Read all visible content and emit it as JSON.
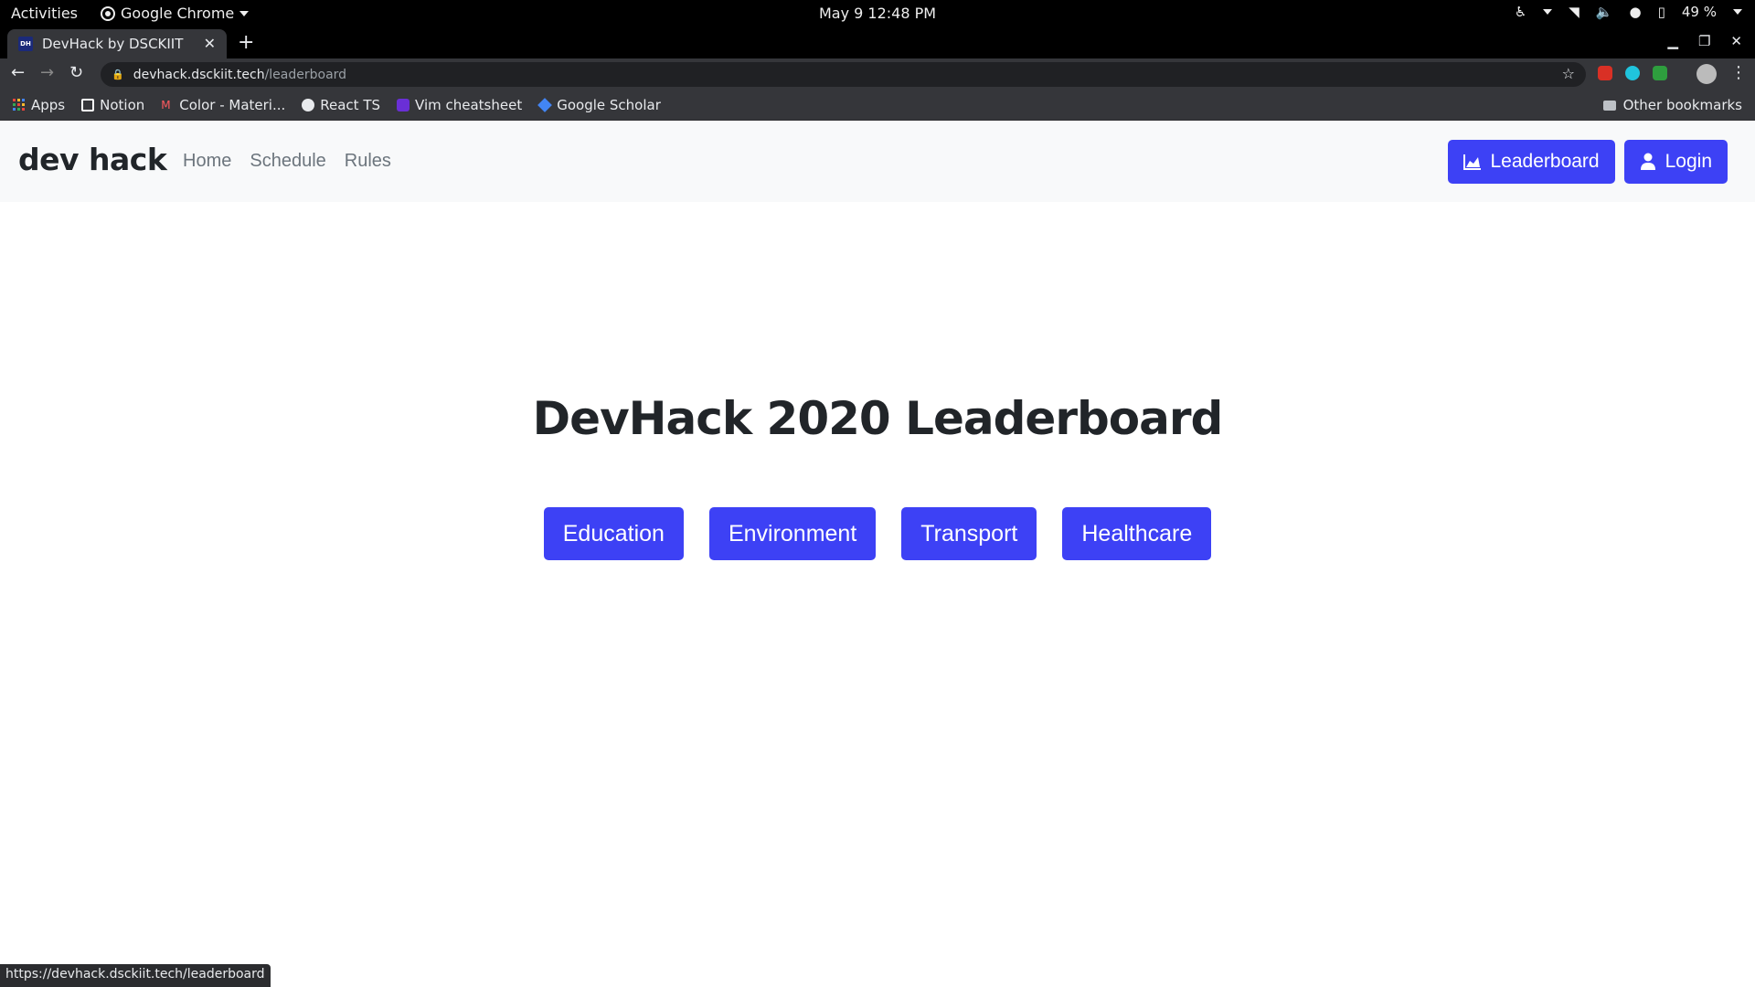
{
  "system": {
    "activities": "Activities",
    "app_name": "Google Chrome",
    "clock": "May 9  12:48 PM",
    "battery": "49 %"
  },
  "browser": {
    "tab_title": "DevHack by DSCKIIT",
    "tab_favicon_text": "DH",
    "url_host": "devhack.dsckiit.tech",
    "url_path": "/leaderboard",
    "status_url": "https://devhack.dsckiit.tech/leaderboard",
    "bookmarks": [
      {
        "label": "Apps",
        "icon": "apps-grid-icon",
        "color": "#e8453c"
      },
      {
        "label": "Notion",
        "icon": "notion-icon",
        "color": "#ffffff"
      },
      {
        "label": "Color - Materi...",
        "icon": "material-color-icon",
        "color": "#ff5a5f"
      },
      {
        "label": "React TS",
        "icon": "github-icon",
        "color": "#e8eaed"
      },
      {
        "label": "Vim cheatsheet",
        "icon": "vim-icon",
        "color": "#6a2fd6"
      },
      {
        "label": "Google Scholar",
        "icon": "scholar-icon",
        "color": "#4285f4"
      }
    ],
    "other_bookmarks": "Other bookmarks"
  },
  "site": {
    "brand": "dev hack",
    "nav_links": [
      "Home",
      "Schedule",
      "Rules"
    ],
    "leaderboard_button": "Leaderboard",
    "login_button": "Login",
    "accent_color": "#3d41f5"
  },
  "main": {
    "title": "DevHack 2020 Leaderboard",
    "categories": [
      "Education",
      "Environment",
      "Transport",
      "Healthcare"
    ]
  }
}
